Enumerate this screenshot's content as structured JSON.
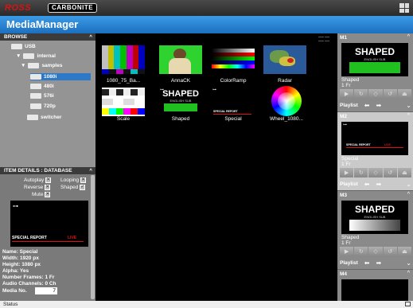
{
  "header": {
    "brand": "ROSS",
    "product": "CARBONITE",
    "app_title": "MediaManager"
  },
  "browse": {
    "title": "BROWSE",
    "tree": [
      {
        "label": "USB",
        "icon": "usb-icon"
      },
      {
        "label": "internal",
        "icon": "folder-icon"
      },
      {
        "label": "samples",
        "icon": "folder-icon"
      },
      {
        "label": "1080i",
        "icon": "folder-icon",
        "selected": true
      },
      {
        "label": "480i",
        "icon": "folder-icon"
      },
      {
        "label": "576i",
        "icon": "folder-icon"
      },
      {
        "label": "720p",
        "icon": "folder-icon"
      },
      {
        "label": "switcher",
        "icon": "folder-icon"
      }
    ]
  },
  "item_details": {
    "title": "ITEM DETAILS : DATABASE",
    "options": {
      "autoplay": "Autoplay",
      "looping": "Looping",
      "reverse": "Reverse",
      "shaped": "Shaped",
      "mute": "Mute"
    },
    "preview_text": "SPECIAL REPORT",
    "preview_live": "LIVE",
    "meta": [
      "Name: Special",
      "Width: 1920 px",
      "Height: 1080 px",
      "Alpha: Yes",
      "Number Frames: 1 Fr",
      "Audio Channels: 0 Ch"
    ],
    "media_no_label": "Media No.",
    "media_no_value": "7"
  },
  "media_grid": {
    "items": [
      {
        "label": "1080_75_Ba..."
      },
      {
        "label": "AnnaCK"
      },
      {
        "label": "ColorRamp"
      },
      {
        "label": "Radar"
      },
      {
        "label": "Scale"
      },
      {
        "label": "Shaped",
        "graphic_title": "SHAPED",
        "graphic_sub": "ENGLISH SUB"
      },
      {
        "label": "Special",
        "graphic_title": "SPECIAL REPORT"
      },
      {
        "label": "Wheel_1080..."
      }
    ]
  },
  "players": [
    {
      "name": "M1",
      "graphic_title": "SHAPED",
      "graphic_sub": "ENGLISH SUB",
      "status_name": "Shaped",
      "status_frames": "1 Fr",
      "playlist": "Playlist"
    },
    {
      "name": "M2",
      "graphic_title": "SPECIAL REPORT",
      "graphic_sub": "LIVE",
      "status_name": "Special",
      "status_frames": "1 Fr",
      "playlist": "Playlist"
    },
    {
      "name": "M3",
      "graphic_title": "SHAPED",
      "graphic_sub": "ENGLISH SUB",
      "status_name": "Shaped",
      "status_frames": "1 Fr",
      "playlist": "Playlist"
    },
    {
      "name": "M4"
    }
  ],
  "statusbar": {
    "text": "Status"
  },
  "colors": {
    "title_blue": "#2a86d6",
    "selected_blue": "#2e78c8",
    "brand_red": "#d11111",
    "shaped_green": "#20c020"
  }
}
